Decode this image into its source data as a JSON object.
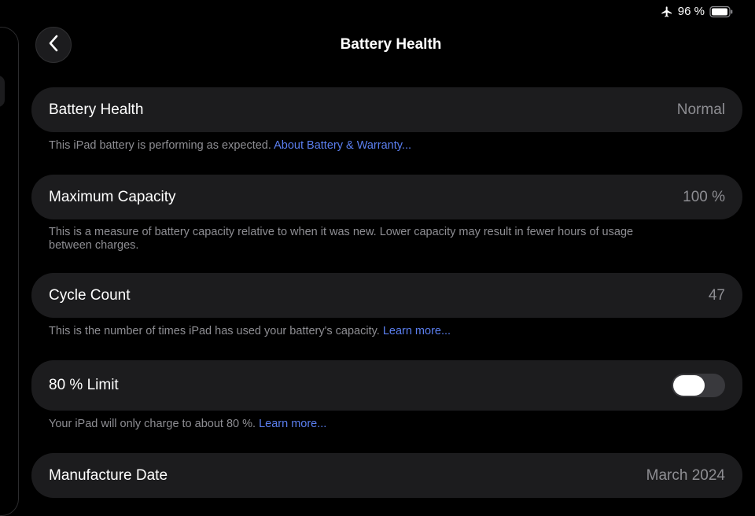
{
  "status": {
    "battery_percent": "96 %",
    "airplane_icon": "airplane-icon",
    "battery_icon": "battery-icon"
  },
  "nav": {
    "title": "Battery Health"
  },
  "battery_health": {
    "label": "Battery Health",
    "value": "Normal",
    "footer_text": "This iPad battery is performing as expected. ",
    "footer_link": "About Battery & Warranty..."
  },
  "maximum_capacity": {
    "label": "Maximum Capacity",
    "value": "100 %",
    "footer_text": "This is a measure of battery capacity relative to when it was new. Lower capacity may result in fewer hours of usage between charges."
  },
  "cycle_count": {
    "label": "Cycle Count",
    "value": "47",
    "footer_text": "This is the number of times iPad has used your battery's capacity. ",
    "footer_link": "Learn more..."
  },
  "limit": {
    "label": "80 % Limit",
    "enabled": false,
    "footer_text": "Your iPad will only charge to about 80 %. ",
    "footer_link": "Learn more..."
  },
  "manufacture_date": {
    "label": "Manufacture Date",
    "value": "March 2024"
  },
  "colors": {
    "background": "#000000",
    "cell": "#1c1c1e",
    "secondary_text": "#8e8e93",
    "link": "#5b7ff0",
    "toggle_off": "#39393d"
  }
}
